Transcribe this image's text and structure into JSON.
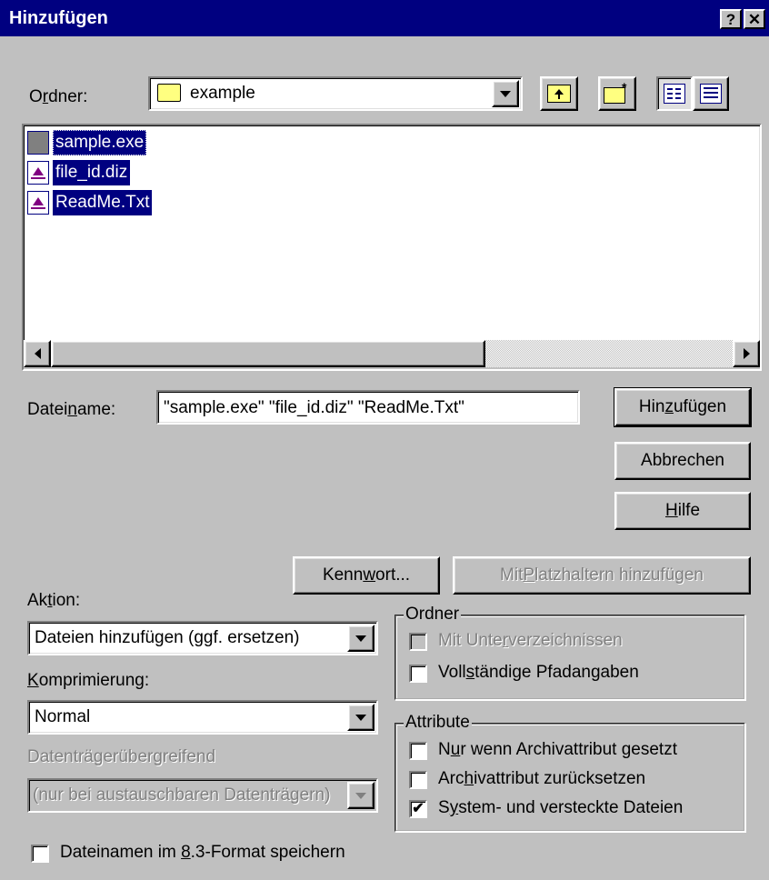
{
  "window": {
    "title": "Hinzufügen",
    "help_button": "?",
    "close_button": "✕"
  },
  "folder": {
    "label": "Ordner:",
    "value": "example"
  },
  "toolbar": {
    "up_icon": "folder-up-icon",
    "new_folder_icon": "new-folder-icon",
    "list_view_icon": "list-view-icon",
    "details_view_icon": "details-view-icon"
  },
  "files": [
    {
      "name": "sample.exe",
      "icon": "exe-file-icon"
    },
    {
      "name": "file_id.diz",
      "icon": "text-file-icon"
    },
    {
      "name": "ReadMe.Txt",
      "icon": "text-file-icon"
    }
  ],
  "filename": {
    "label": "Dateiname:",
    "value": "\"sample.exe\" \"file_id.diz\" \"ReadMe.Txt\""
  },
  "buttons": {
    "add": "Hinzufügen",
    "cancel": "Abbrechen",
    "help": "Hilfe",
    "password": "Kennwort...",
    "add_wildcards": "Mit Platzhaltern hinzufügen"
  },
  "action": {
    "label": "Aktion:",
    "value": "Dateien hinzufügen (ggf. ersetzen)"
  },
  "compression": {
    "label": "Komprimierung:",
    "value": "Normal"
  },
  "span": {
    "label": "Datenträgerübergreifend",
    "value": "(nur bei austauschbaren Datenträgern)"
  },
  "store_83": {
    "label": "Dateinamen im 8.3-Format speichern",
    "checked": false
  },
  "folder_group": {
    "title": "Ordner",
    "recurse": {
      "label": "Mit Unterverzeichnissen",
      "checked": false,
      "enabled": false
    },
    "full_paths": {
      "label": "Vollständige Pfadangaben",
      "checked": false
    }
  },
  "attributes_group": {
    "title": "Attribute",
    "only_archive": {
      "label": "Nur wenn Archivattribut gesetzt",
      "checked": false
    },
    "reset_archive": {
      "label": "Archivattribut zurücksetzen",
      "checked": false
    },
    "system_hidden": {
      "label": "System- und versteckte Dateien",
      "checked": true
    }
  }
}
